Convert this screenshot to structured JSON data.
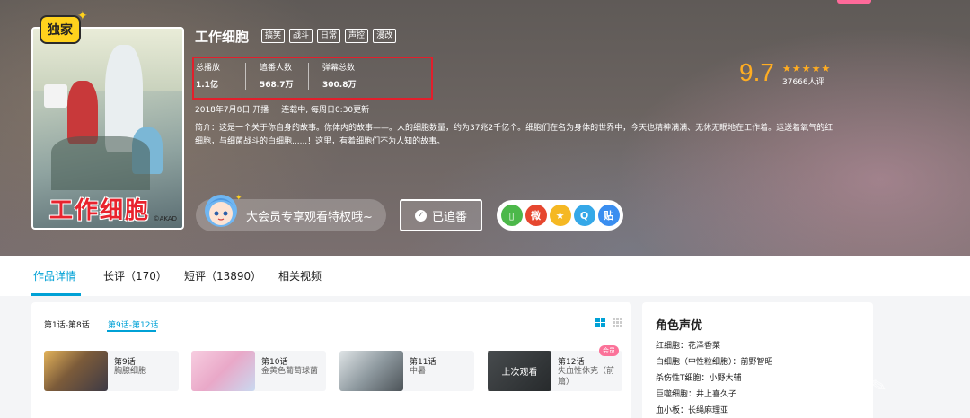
{
  "hero": {
    "exclusive_badge": "独家",
    "poster_title": "工作细胞",
    "poster_credit": "©AKAD",
    "title": "工作细胞",
    "tags": [
      "搞笑",
      "战斗",
      "日常",
      "声控",
      "漫改"
    ],
    "stats": [
      {
        "label": "总播放",
        "value": "1.1亿"
      },
      {
        "label": "追番人数",
        "value": "568.7万"
      },
      {
        "label": "弹幕总数",
        "value": "300.8万"
      }
    ],
    "premiere": "2018年7月8日 开播",
    "schedule": "连载中, 每周日0:30更新",
    "description": "简介：这是一个关于你自身的故事。你体内的故事——。人的细胞数量，约为37兆2千亿个。细胞们在名为身体的世界中，今天也精神满满、无休无眠地在工作着。运送着氧气的红细胞，与细菌战斗的白细胞......！这里，有着细胞们不为人知的故事。",
    "score": "9.7",
    "stars": 5,
    "rating_count": "37666人评",
    "vip_text": "大会员专享观看特权哦~",
    "follow_label": "已追番",
    "share": [
      {
        "icon": "phone-icon",
        "glyph": "▯",
        "color": "#4cb84a"
      },
      {
        "icon": "weibo-icon",
        "glyph": "微",
        "color": "#e6472f"
      },
      {
        "icon": "qzone-icon",
        "glyph": "★",
        "color": "#f5b823"
      },
      {
        "icon": "qq-icon",
        "glyph": "Q",
        "color": "#35a8e8"
      },
      {
        "icon": "tieba-icon",
        "glyph": "贴",
        "color": "#3a8ef0"
      }
    ]
  },
  "tabs": [
    {
      "label": "作品详情",
      "active": true
    },
    {
      "label": "长评（170）",
      "active": false
    },
    {
      "label": "短评（13890）",
      "active": false
    },
    {
      "label": "相关视频",
      "active": false
    }
  ],
  "episodes": {
    "ranges": [
      {
        "label": "第1话-第8话",
        "active": false
      },
      {
        "label": "第9话-第12话",
        "active": true
      }
    ],
    "items": [
      {
        "number": "第9话",
        "title": "胸腺细胞"
      },
      {
        "number": "第10话",
        "title": "金黄色葡萄球菌"
      },
      {
        "number": "第11话",
        "title": "中暑"
      },
      {
        "number": "第12话",
        "title": "失血性休克（前篇）",
        "resume": "上次观看",
        "badge": "会员"
      }
    ]
  },
  "cast": {
    "title": "角色声优",
    "items": [
      "红细胞：花泽香菜",
      "白细胞（中性粒细胞）：前野智昭",
      "杀伤性T细胞：小野大辅",
      "巨噬细胞：井上喜久子",
      "血小板：长绳麻理亚"
    ]
  }
}
